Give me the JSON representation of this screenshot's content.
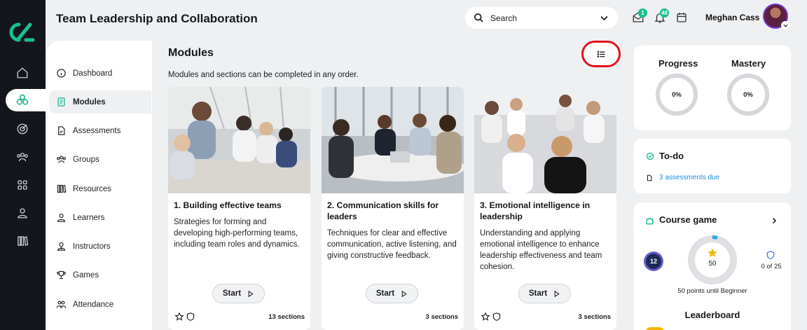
{
  "header": {
    "page_title": "Team Leadership and Collaboration",
    "search_label": "Search",
    "messages_badge": "1",
    "notifications_badge": "48",
    "user_name": "Meghan Cass"
  },
  "rail": {
    "icons": [
      "home-icon",
      "modules-icon",
      "target-icon",
      "groups-icon",
      "apps-icon",
      "profile-icon",
      "library-icon"
    ],
    "active": "modules-icon"
  },
  "sidebar": {
    "items": [
      {
        "label": "Dashboard",
        "icon": "info-icon"
      },
      {
        "label": "Modules",
        "icon": "document-icon",
        "active": true
      },
      {
        "label": "Assessments",
        "icon": "assessment-icon"
      },
      {
        "label": "Groups",
        "icon": "groups-icon"
      },
      {
        "label": "Resources",
        "icon": "books-icon"
      },
      {
        "label": "Learners",
        "icon": "user-icon"
      },
      {
        "label": "Instructors",
        "icon": "instructor-icon"
      },
      {
        "label": "Games",
        "icon": "trophy-icon"
      },
      {
        "label": "Attendance",
        "icon": "attendance-icon"
      }
    ]
  },
  "main": {
    "title": "Modules",
    "description": "Modules and sections can be completed in any order.",
    "start_label": "Start",
    "modules": [
      {
        "title": "1. Building effective teams",
        "description": "Strategies for forming and developing high-performing teams, including team roles and dynamics.",
        "sections": "13 sections"
      },
      {
        "title": "2. Communication skills for leaders",
        "description": "Techniques for clear and effective communication, active listening, and giving constructive feedback.",
        "sections": "3 sections"
      },
      {
        "title": "3. Emotional intelligence in leadership",
        "description": "Understanding and applying emotional intelligence to enhance leadership effectiveness and team cohesion.",
        "sections": "3 sections"
      }
    ]
  },
  "right": {
    "progress_label": "Progress",
    "progress_value": "0%",
    "mastery_label": "Mastery",
    "mastery_value": "0%",
    "todo_title": "To-do",
    "todo_link": "3 assessments due",
    "game_title": "Course game",
    "game_level": "12",
    "game_points": "50",
    "game_badges": "0 of 25",
    "game_until": "50 points until Beginner",
    "leaderboard_title": "Leaderboard"
  },
  "colors": {
    "accent": "#0fb58a",
    "rail": "#14161d",
    "highlight_ring": "#e3121b",
    "link": "#1a8fd6"
  }
}
